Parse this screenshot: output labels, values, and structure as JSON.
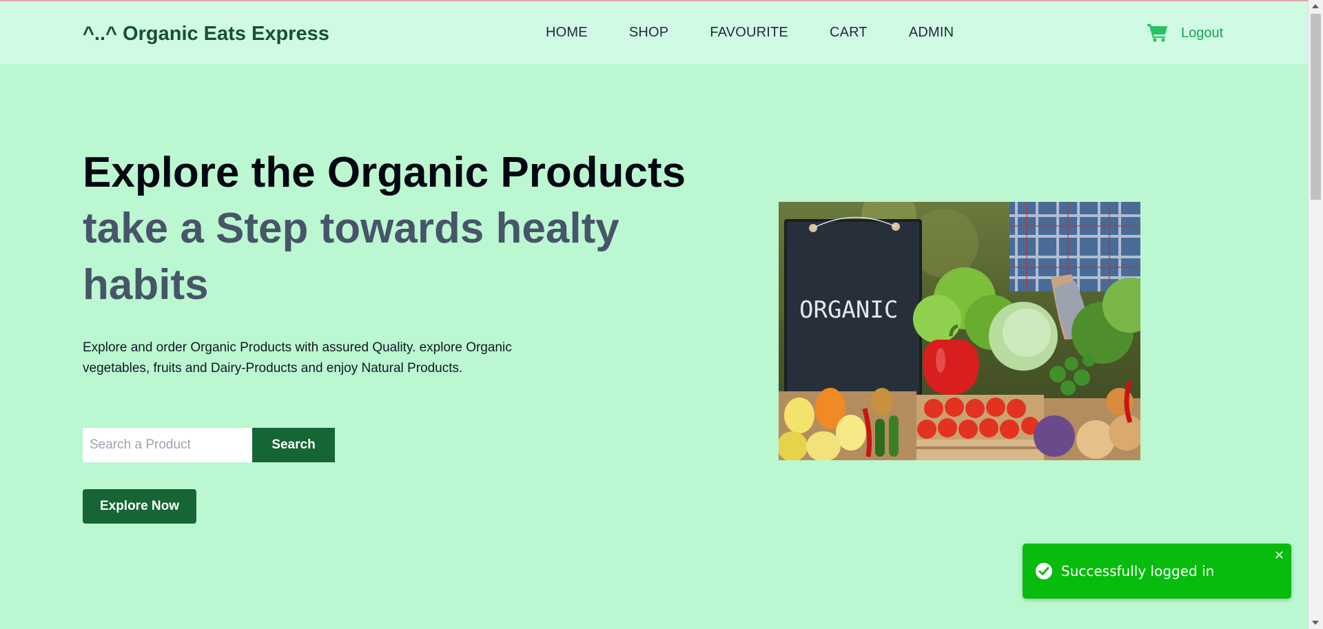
{
  "header": {
    "brand": "^..^ Organic Eats Express",
    "nav": [
      "HOME",
      "SHOP",
      "FAVOURITE",
      "CART",
      "ADMIN"
    ],
    "cart_icon": "cart-icon",
    "logout_label": "Logout"
  },
  "hero": {
    "title": "Explore the Organic Products",
    "subtitle": "take a Step towards healty habits",
    "description": "Explore and order Organic Products with assured Quality. explore Organic vegetables, fruits and Dairy-Products and enjoy Natural Products.",
    "search_placeholder": "Search a Product",
    "search_label": "Search",
    "explore_label": "Explore Now",
    "image_sign_text": "ORGANIC"
  },
  "toast": {
    "message": "Successfully logged in",
    "close": "✕"
  },
  "colors": {
    "background": "#bbf7d0",
    "header": "#d1fae5",
    "primary": "#166534",
    "accent": "#16a34a",
    "toast": "#07bc0c"
  }
}
